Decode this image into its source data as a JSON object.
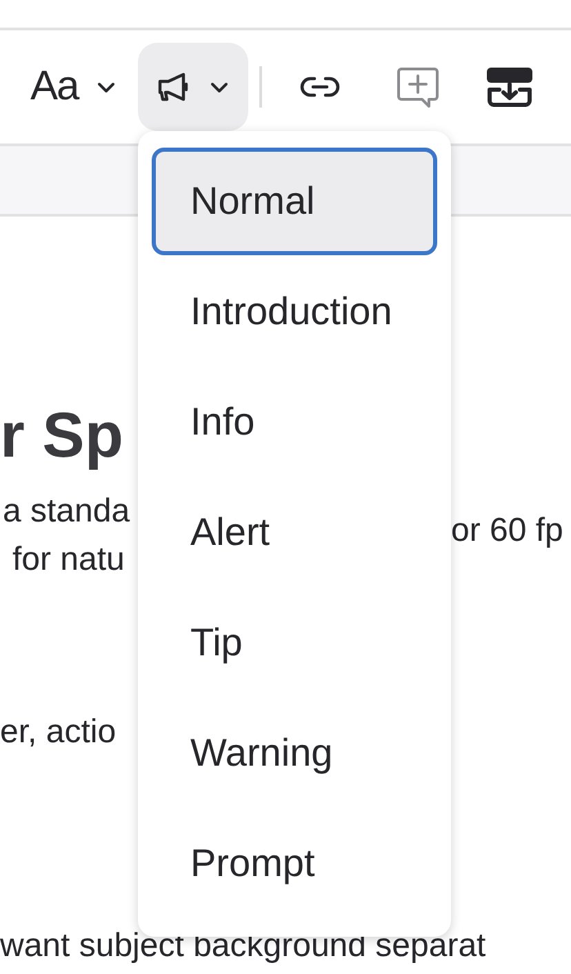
{
  "toolbar": {
    "items": [
      {
        "kind": "text-style",
        "label": "Aa",
        "open": false
      },
      {
        "kind": "callout",
        "open": true
      },
      {
        "kind": "separator"
      },
      {
        "kind": "link"
      },
      {
        "kind": "comment",
        "disabled": true
      },
      {
        "kind": "insert",
        "disabled": false
      }
    ]
  },
  "callout_menu": {
    "items": [
      {
        "label": "Normal",
        "selected": true
      },
      {
        "label": "Introduction",
        "selected": false
      },
      {
        "label": "Info",
        "selected": false
      },
      {
        "label": "Alert",
        "selected": false
      },
      {
        "label": "Tip",
        "selected": false
      },
      {
        "label": "Warning",
        "selected": false
      },
      {
        "label": "Prompt",
        "selected": false
      }
    ]
  },
  "document": {
    "heading": "r Sp",
    "left_lines": [
      "a standa",
      "for natu",
      "er, actio"
    ],
    "right_lines": [
      "or 60 fp"
    ],
    "bottom_line": "want subject background separat"
  }
}
